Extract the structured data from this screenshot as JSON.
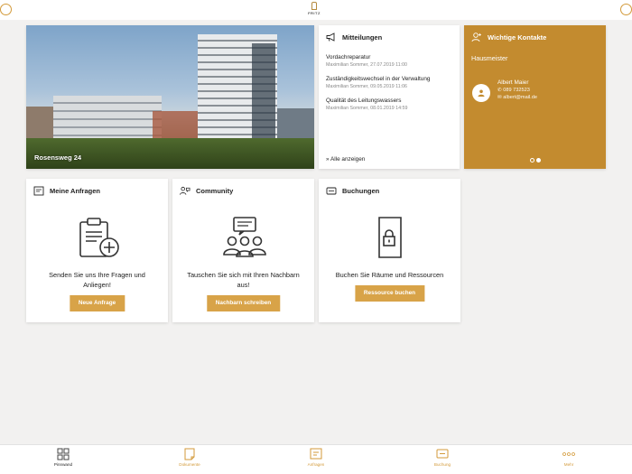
{
  "hero": {
    "caption": "Rosensweg 24"
  },
  "news": {
    "title": "Mitteilungen",
    "items": [
      {
        "title": "Vordachreparatur",
        "meta": "Maximilian Sommer, 27.07.2019 11:00"
      },
      {
        "title": "Zuständigkeitswechsel in der Verwaltung",
        "meta": "Maximilian Sommer, 09.05.2019 11:06"
      },
      {
        "title": "Qualität des Leitungswassers",
        "meta": "Maximilian Sommer, 08.01.2019 14:59"
      }
    ],
    "all_label": "» Alle anzeigen"
  },
  "contacts": {
    "title": "Wichtige Kontakte",
    "role": "Hausmeister",
    "name": "Albert Maier",
    "phone": "089 732523",
    "email": "albert@mail.de",
    "accent": "#c38b2f"
  },
  "features": [
    {
      "title": "Meine Anfragen",
      "desc": "Senden Sie uns Ihre Fragen und Anliegen!",
      "button": "Neue Anfrage"
    },
    {
      "title": "Community",
      "desc": "Tauschen Sie sich mit Ihren Nachbarn aus!",
      "button": "Nachbarn schreiben"
    },
    {
      "title": "Buchungen",
      "desc": "Buchen Sie Räume und Ressourcen",
      "button": "Ressource buchen"
    }
  ],
  "tabs": [
    {
      "label": "Pinnwand",
      "icon": "grid-icon",
      "active": true
    },
    {
      "label": "Dokumente",
      "icon": "document-icon",
      "active": false
    },
    {
      "label": "Anfragen",
      "icon": "request-icon",
      "active": false
    },
    {
      "label": "Buchung",
      "icon": "booking-icon",
      "active": false
    },
    {
      "label": "Mehr",
      "icon": "more-icon",
      "active": false
    }
  ],
  "colors": {
    "accent": "#d8a348",
    "brand": "#c38b2f"
  }
}
